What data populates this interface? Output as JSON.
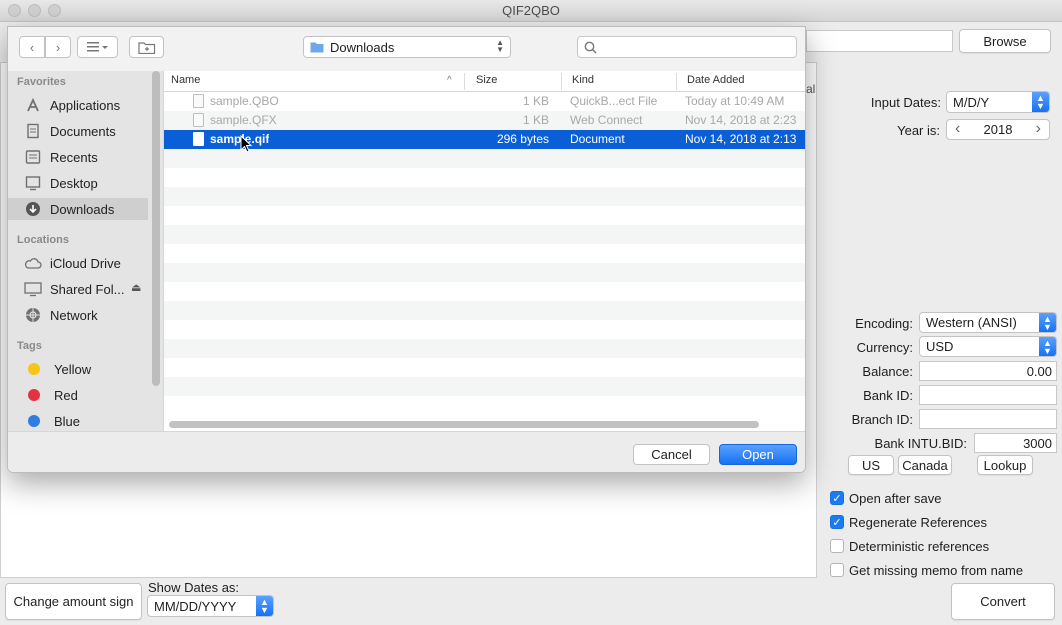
{
  "window": {
    "title": "QIF2QBO"
  },
  "main": {
    "browse_label": "Browse",
    "partial_text": "al",
    "input_dates": {
      "label": "Input Dates:",
      "value": "M/D/Y"
    },
    "year": {
      "label": "Year is:",
      "value": "2018",
      "prev": "‹",
      "next": "›"
    },
    "encoding": {
      "label": "Encoding:",
      "value": "Western (ANSI)"
    },
    "currency": {
      "label": "Currency:",
      "value": "USD"
    },
    "balance": {
      "label": "Balance:",
      "value": "0.00"
    },
    "bank_id": {
      "label": "Bank ID:",
      "value": ""
    },
    "branch_id": {
      "label": "Branch ID:",
      "value": ""
    },
    "bank_intu_bid": {
      "label": "Bank INTU.BID:",
      "value": "3000"
    },
    "region_buttons": {
      "us": "US",
      "canada": "Canada",
      "lookup": "Lookup"
    },
    "options": [
      {
        "label": "Open after save",
        "checked": true
      },
      {
        "label": "Regenerate References",
        "checked": true
      },
      {
        "label": "Deterministic references",
        "checked": false
      },
      {
        "label": "Get missing memo from name",
        "checked": false
      }
    ],
    "change_sign_label": "Change amount sign",
    "show_dates": {
      "label": "Show Dates as:",
      "value": "MM/DD/YYYY"
    },
    "convert_label": "Convert"
  },
  "dialog": {
    "location": "Downloads",
    "search_placeholder": "",
    "sidebar": {
      "favorites_heading": "Favorites",
      "favorites": [
        {
          "label": "Applications",
          "icon": "applications-icon"
        },
        {
          "label": "Documents",
          "icon": "documents-icon"
        },
        {
          "label": "Recents",
          "icon": "recents-icon"
        },
        {
          "label": "Desktop",
          "icon": "desktop-icon"
        },
        {
          "label": "Downloads",
          "icon": "downloads-icon",
          "selected": true
        }
      ],
      "locations_heading": "Locations",
      "locations": [
        {
          "label": "iCloud Drive",
          "icon": "cloud-icon"
        },
        {
          "label": "Shared Fol...",
          "icon": "display-icon",
          "eject": "⏏"
        },
        {
          "label": "Network",
          "icon": "network-icon"
        }
      ],
      "tags_heading": "Tags",
      "tags": [
        {
          "label": "Yellow",
          "color": "#f5c518"
        },
        {
          "label": "Red",
          "color": "#e5323f"
        },
        {
          "label": "Blue",
          "color": "#2f7de1"
        }
      ]
    },
    "columns": {
      "name": "Name",
      "sort_indicator": "^",
      "size": "Size",
      "kind": "Kind",
      "date_added": "Date Added"
    },
    "files": [
      {
        "name": "sample.QBO",
        "size": "1 KB",
        "kind": "QuickB...ect File",
        "date": "Today at 10:49 AM",
        "enabled": false,
        "selected": false
      },
      {
        "name": "sample.QFX",
        "size": "1 KB",
        "kind": "Web Connect",
        "date": "Nov 14, 2018 at 2:23",
        "enabled": false,
        "selected": false
      },
      {
        "name": "sample.qif",
        "size": "296 bytes",
        "kind": "Document",
        "date": "Nov 14, 2018 at 2:13",
        "enabled": true,
        "selected": true
      }
    ],
    "cancel_label": "Cancel",
    "open_label": "Open",
    "colors": {
      "accent": "#1a7bf2",
      "selection": "#0a5fd6"
    }
  }
}
